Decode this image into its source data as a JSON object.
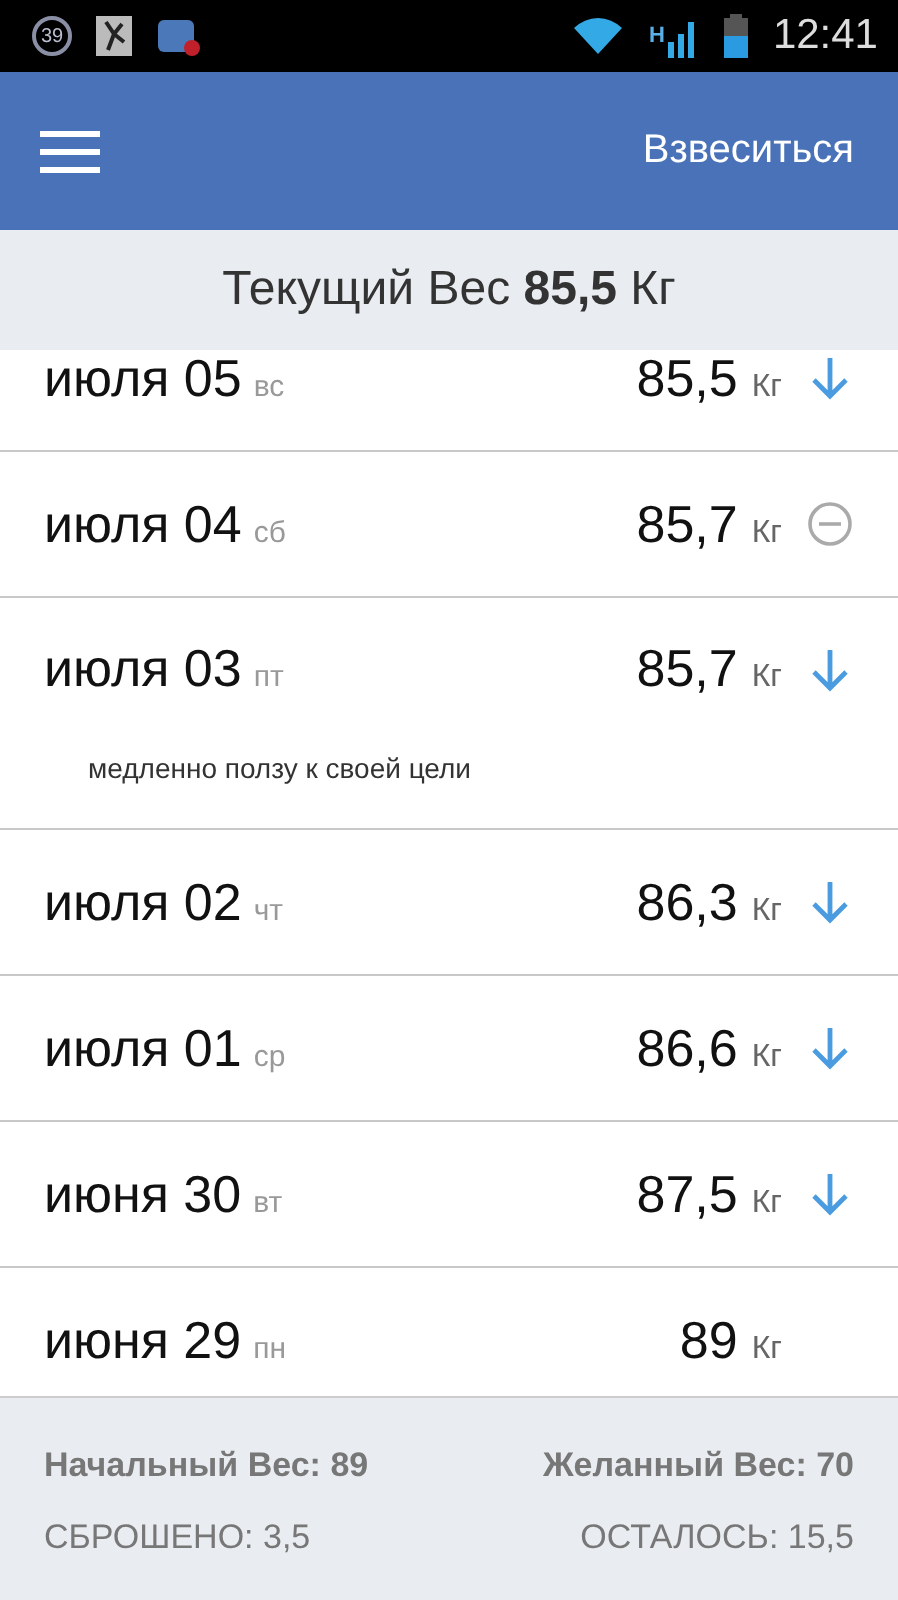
{
  "status_bar": {
    "notification_count": "39",
    "network_type": "H",
    "time": "12:41"
  },
  "app_bar": {
    "action": "Взвеситься"
  },
  "current_weight": "Текущий Вес **85,5** Кг",
  "entries": [
    {
      "date": "июля 05",
      "weekday": "вс",
      "weight": "85,5",
      "unit": "Кг",
      "kind": "down"
    },
    {
      "date": "июля 04",
      "weekday": "сб",
      "weight": "85,7",
      "unit": "Кг",
      "kind": "same"
    },
    {
      "date": "июля 03",
      "weekday": "пт",
      "weight": "85,7",
      "unit": "Кг",
      "kind": "down",
      "note": "медленно ползу к своей цели"
    },
    {
      "date": "июля 02",
      "weekday": "чт",
      "weight": "86,3",
      "unit": "Кг",
      "kind": "down"
    },
    {
      "date": "июля 01",
      "weekday": "ср",
      "weight": "86,6",
      "unit": "Кг",
      "kind": "down"
    },
    {
      "date": "июня 30",
      "weekday": "вт",
      "weight": "87,5",
      "unit": "Кг",
      "kind": "down"
    },
    {
      "date": "июня 29",
      "weekday": "пн",
      "weight": "89",
      "unit": "Кг",
      "kind": "none"
    }
  ],
  "summary": {
    "start": "Начальный Вес: 89",
    "goal": "Желанный Вес: 70",
    "lost": "СБРОШЕНО: 3,5",
    "left": "ОСТАЛОСЬ: 15,5"
  }
}
